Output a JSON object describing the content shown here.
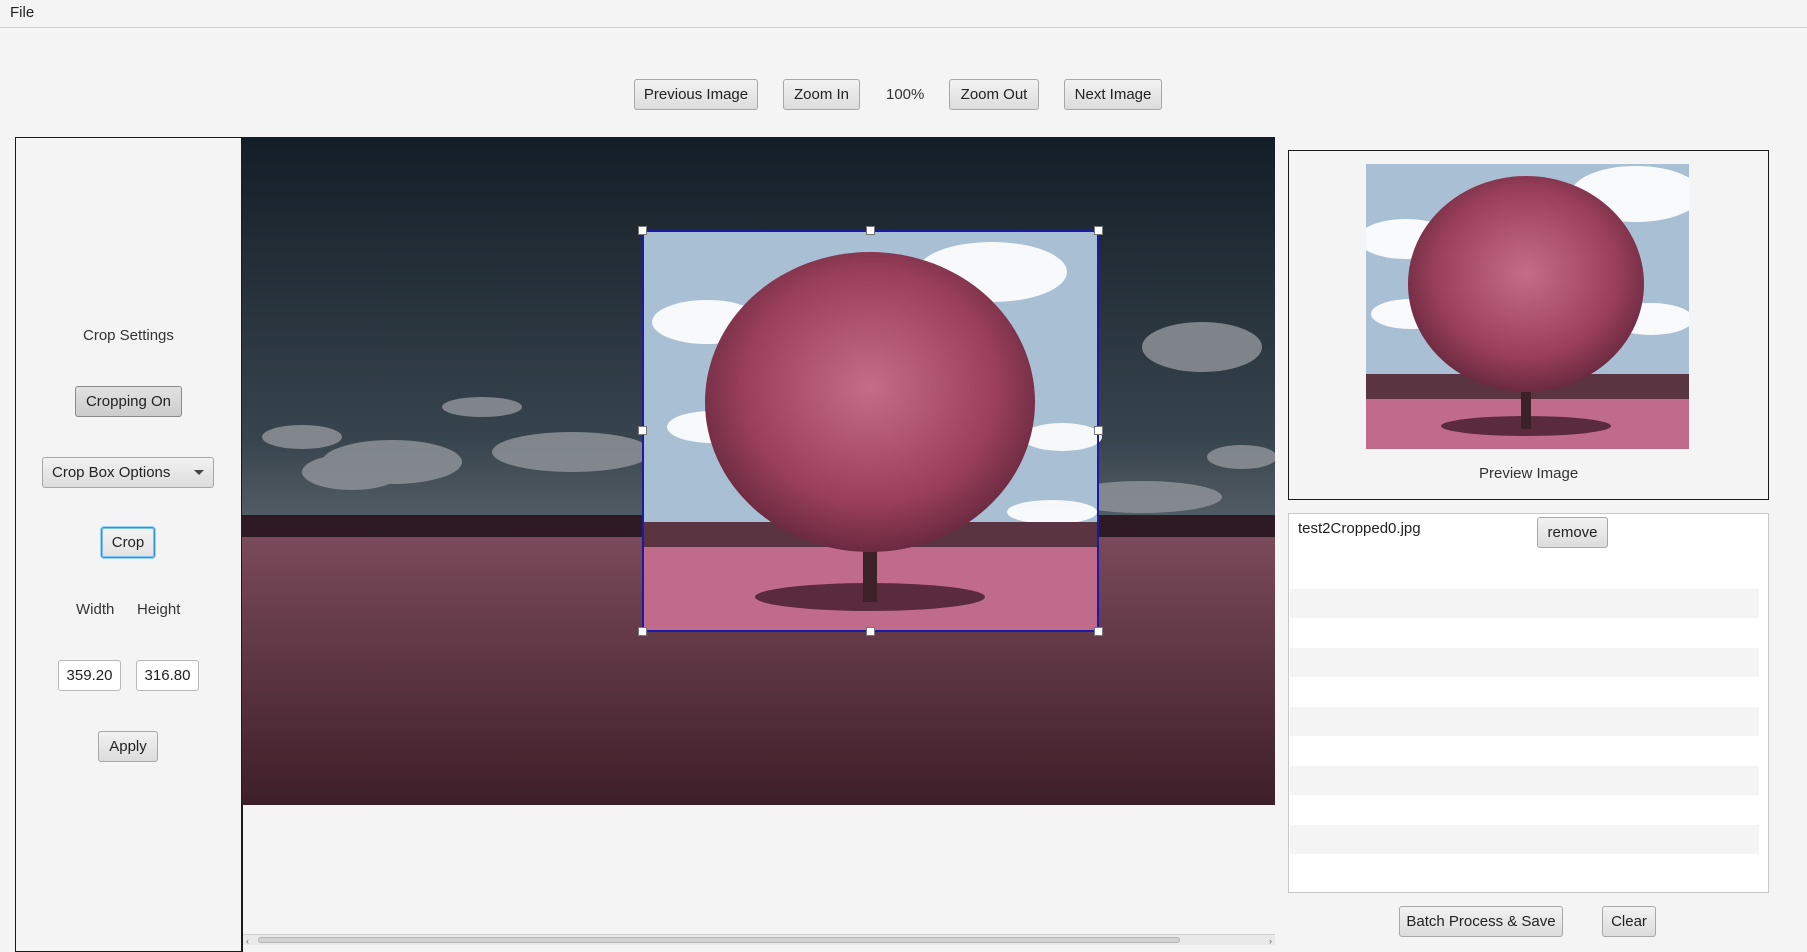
{
  "menu": {
    "file": "File"
  },
  "toolbar": {
    "previous_label": "Previous Image",
    "zoom_in_label": "Zoom In",
    "zoom_level": "100%",
    "zoom_out_label": "Zoom Out",
    "next_label": "Next Image"
  },
  "crop_panel": {
    "title": "Crop Settings",
    "cropping_toggle_label": "Cropping On",
    "crop_box_options_label": "Crop Box Options",
    "crop_button_label": "Crop",
    "width_label": "Width",
    "height_label": "Height",
    "width_value": "359.20",
    "height_value": "316.80",
    "apply_label": "Apply"
  },
  "preview": {
    "caption": "Preview Image"
  },
  "file_list": {
    "items": [
      {
        "name": "test2Cropped0.jpg",
        "remove_label": "remove"
      }
    ]
  },
  "bottom_actions": {
    "batch_label": "Batch Process & Save",
    "clear_label": "Clear"
  },
  "colors": {
    "crop_box_border": "#1e1aa8",
    "focus_ring": "#2f93d6",
    "field_color": "#a85a78",
    "sky_top": "#1d2a35"
  },
  "icons": [
    "chevron-down-icon",
    "scroll-left-icon",
    "scroll-right-icon"
  ]
}
